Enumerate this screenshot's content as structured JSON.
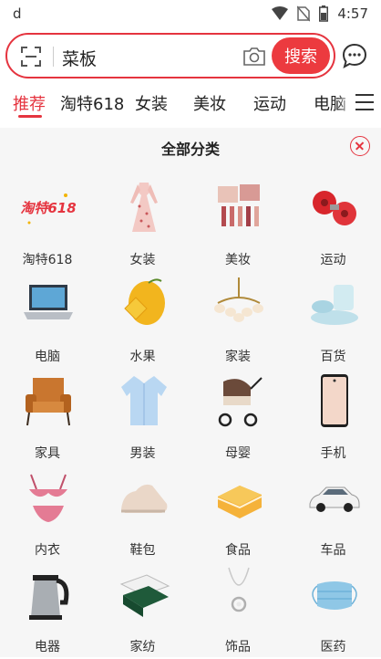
{
  "status": {
    "app_letter": "d",
    "time": "4:57"
  },
  "search": {
    "value": "菜板",
    "button_label": "搜索"
  },
  "tabs": [
    {
      "label": "推荐"
    },
    {
      "label": "淘特618"
    },
    {
      "label": "女装"
    },
    {
      "label": "美妆"
    },
    {
      "label": "运动"
    },
    {
      "label": "电脑"
    }
  ],
  "panel": {
    "title": "全部分类"
  },
  "categories": [
    {
      "label": "淘特618",
      "icon": "taote618-logo"
    },
    {
      "label": "女装",
      "icon": "floral-dress"
    },
    {
      "label": "美妆",
      "icon": "makeup-palette"
    },
    {
      "label": "运动",
      "icon": "red-dumbbells"
    },
    {
      "label": "电脑",
      "icon": "laptop"
    },
    {
      "label": "水果",
      "icon": "mango"
    },
    {
      "label": "家装",
      "icon": "chandelier"
    },
    {
      "label": "百货",
      "icon": "dish-set"
    },
    {
      "label": "家具",
      "icon": "armchair"
    },
    {
      "label": "男装",
      "icon": "shirt"
    },
    {
      "label": "母婴",
      "icon": "stroller"
    },
    {
      "label": "手机",
      "icon": "smartphone"
    },
    {
      "label": "内衣",
      "icon": "lingerie"
    },
    {
      "label": "鞋包",
      "icon": "sneaker"
    },
    {
      "label": "食品",
      "icon": "cake"
    },
    {
      "label": "车品",
      "icon": "car"
    },
    {
      "label": "电器",
      "icon": "kettle"
    },
    {
      "label": "家纺",
      "icon": "bedding"
    },
    {
      "label": "饰品",
      "icon": "necklace"
    },
    {
      "label": "医药",
      "icon": "face-mask"
    }
  ],
  "colors": {
    "accent": "#e5343f",
    "panel_bg": "#f6f6f6"
  }
}
